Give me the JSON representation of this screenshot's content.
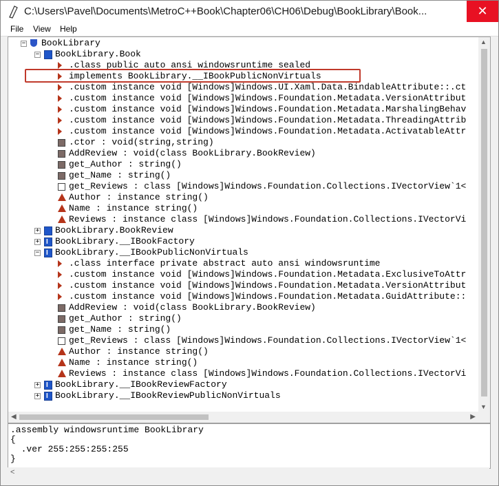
{
  "window": {
    "title": "C:\\Users\\Pavel\\Documents\\MetroC++Book\\Chapter06\\CH06\\Debug\\BookLibrary\\Book...",
    "close_glyph": "✕"
  },
  "menu": {
    "file": "File",
    "view": "View",
    "help": "Help"
  },
  "tree": [
    {
      "text": "BookLibrary",
      "icon": "assembly-icon",
      "expander": "⊟"
    },
    {
      "text": "BookLibrary.Book",
      "icon": "class-icon",
      "expander": "⊟"
    },
    {
      "text": ".class public auto ansi windowsruntime sealed",
      "icon": "arrow-icon"
    },
    {
      "text": "implements BookLibrary.__IBookPublicNonVirtuals",
      "icon": "arrow-icon"
    },
    {
      "text": ".custom instance void [Windows]Windows.UI.Xaml.Data.BindableAttribute::.ct",
      "icon": "arrow-icon"
    },
    {
      "text": ".custom instance void [Windows]Windows.Foundation.Metadata.VersionAttribut",
      "icon": "arrow-icon"
    },
    {
      "text": ".custom instance void [Windows]Windows.Foundation.Metadata.MarshalingBehav",
      "icon": "arrow-icon"
    },
    {
      "text": ".custom instance void [Windows]Windows.Foundation.Metadata.ThreadingAttrib",
      "icon": "arrow-icon"
    },
    {
      "text": ".custom instance void [Windows]Windows.Foundation.Metadata.ActivatableAttr",
      "icon": "arrow-icon"
    },
    {
      "text": ".ctor : void(string,string)",
      "icon": "method-icon"
    },
    {
      "text": "AddReview : void(class BookLibrary.BookReview)",
      "icon": "method-icon"
    },
    {
      "text": "get_Author : string()",
      "icon": "method-icon"
    },
    {
      "text": "get_Name : string()",
      "icon": "method-icon"
    },
    {
      "text": "get_Reviews : class [Windows]Windows.Foundation.Collections.IVectorView`1<",
      "icon": "method-icon"
    },
    {
      "text": "Author : instance string()",
      "icon": "property-icon"
    },
    {
      "text": "Name : instance string()",
      "icon": "property-icon"
    },
    {
      "text": "Reviews : instance class [Windows]Windows.Foundation.Collections.IVectorVi",
      "icon": "property-icon"
    },
    {
      "text": "BookLibrary.BookReview",
      "icon": "class-icon",
      "expander": "⊞"
    },
    {
      "text": "BookLibrary.__IBookFactory",
      "icon": "interface-icon",
      "expander": "⊞"
    },
    {
      "text": "BookLibrary.__IBookPublicNonVirtuals",
      "icon": "interface-icon",
      "expander": "⊟"
    },
    {
      "text": ".class interface private abstract auto ansi windowsruntime",
      "icon": "arrow-icon"
    },
    {
      "text": ".custom instance void [Windows]Windows.Foundation.Metadata.ExclusiveToAttr",
      "icon": "arrow-icon"
    },
    {
      "text": ".custom instance void [Windows]Windows.Foundation.Metadata.VersionAttribut",
      "icon": "arrow-icon"
    },
    {
      "text": ".custom instance void [Windows]Windows.Foundation.Metadata.GuidAttribute::",
      "icon": "arrow-icon"
    },
    {
      "text": "AddReview : void(class BookLibrary.BookReview)",
      "icon": "method-icon"
    },
    {
      "text": "get_Author : string()",
      "icon": "method-icon"
    },
    {
      "text": "get_Name : string()",
      "icon": "method-icon"
    },
    {
      "text": "get_Reviews : class [Windows]Windows.Foundation.Collections.IVectorView`1<",
      "icon": "method-icon"
    },
    {
      "text": "Author : instance string()",
      "icon": "property-icon"
    },
    {
      "text": "Name : instance string()",
      "icon": "property-icon"
    },
    {
      "text": "Reviews : instance class [Windows]Windows.Foundation.Collections.IVectorVi",
      "icon": "property-icon"
    },
    {
      "text": "BookLibrary.__IBookReviewFactory",
      "icon": "interface-icon",
      "expander": "⊞"
    },
    {
      "text": "BookLibrary.__IBookReviewPublicNonVirtuals",
      "icon": "interface-icon",
      "expander": "⊞"
    }
  ],
  "disassembly": {
    "line1": ".assembly windowsruntime BookLibrary",
    "line2": "{",
    "line3": "  .ver 255:255:255:255",
    "line4": "}"
  },
  "colors": {
    "highlight": "#c0392b",
    "class_icon": "#1f56c9",
    "attribute_icon": "#b5341a",
    "close_button": "#e81123"
  }
}
